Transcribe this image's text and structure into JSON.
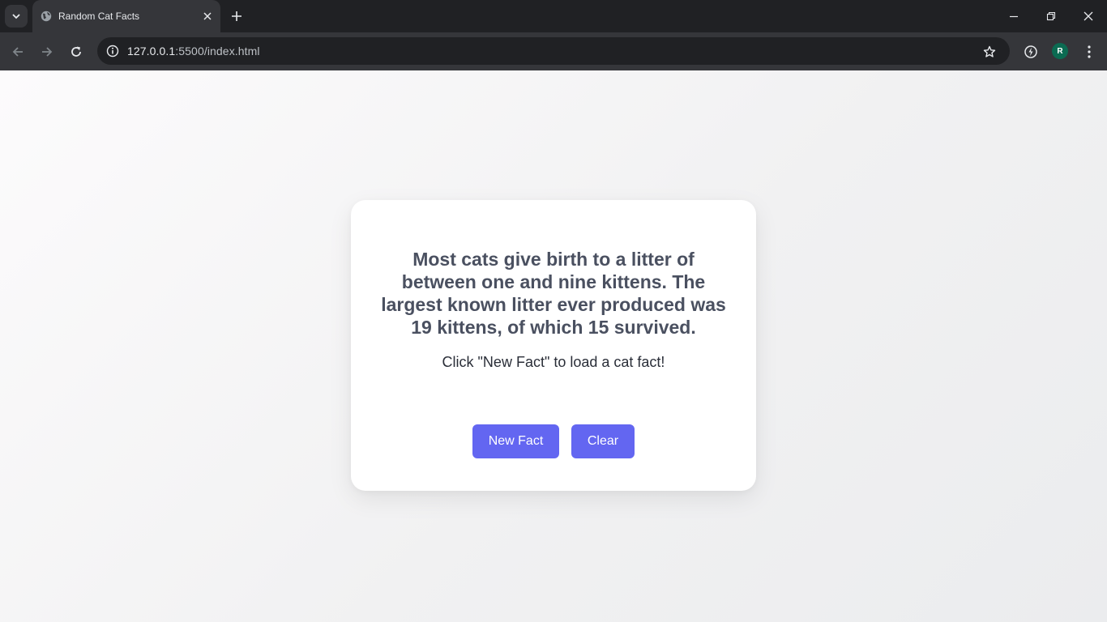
{
  "browser": {
    "tab": {
      "title": "Random Cat Facts"
    },
    "address_bar": {
      "host": "127.0.0.1",
      "path": ":5500/index.html"
    },
    "profile": {
      "initial": "R",
      "color": "#0b6b52"
    }
  },
  "page": {
    "fact": "Most cats give birth to a litter of between one and nine kittens. The largest known litter ever produced was 19 kittens, of which 15 survived.",
    "hint": "Click \"New Fact\" to load a cat fact!",
    "buttons": {
      "new_fact": "New Fact",
      "clear": "Clear"
    },
    "accent_color": "#6366f1"
  },
  "icons": [
    "tab-search-icon",
    "globe-icon",
    "close-icon",
    "plus-icon",
    "minimize-icon",
    "restore-icon",
    "window-close-icon",
    "back-arrow-icon",
    "forward-arrow-icon",
    "reload-icon",
    "site-info-icon",
    "star-icon",
    "extension-icon",
    "menu-dots-icon"
  ]
}
